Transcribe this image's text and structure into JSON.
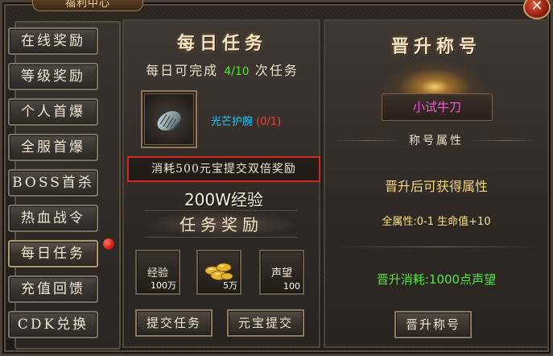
{
  "window": {
    "title": "福利中心",
    "close_label": "✕"
  },
  "sidebar": {
    "items": [
      {
        "label": "在线奖励"
      },
      {
        "label": "等级奖励"
      },
      {
        "label": "个人首爆"
      },
      {
        "label": "全服首爆"
      },
      {
        "label": "BOSS首杀"
      },
      {
        "label": "热血战令"
      },
      {
        "label": "每日任务"
      },
      {
        "label": "充值回馈"
      },
      {
        "label": "CDK兑换"
      }
    ],
    "active_index": 6,
    "notification_dot_on": "每日任务"
  },
  "daily_task": {
    "title": "每日任务",
    "prefix": "每日可完成",
    "count": "4/10",
    "suffix": "次任务",
    "item": {
      "icon": "bracer-icon",
      "name": "光芒护腕",
      "progress": "(0/1)"
    },
    "double_reward_note": "消耗500元宝提交双倍奖励",
    "exp_text": "200W经验",
    "reward_title": "任务奖励",
    "rewards": [
      {
        "label": "经验",
        "count": "100万"
      },
      {
        "label": "",
        "icon": "gold-ingot-icon",
        "count": "5万"
      },
      {
        "label": "声望",
        "count": "100"
      }
    ],
    "submit_button": "提交任务",
    "ingot_submit_button": "元宝提交"
  },
  "promotion": {
    "title": "晋升称号",
    "current_title": "小试牛刀",
    "attr_section": "称号属性",
    "gain_text": "晋升后可获得属性",
    "attributes": "全属性:0-1  生命值+10",
    "cost_text": "晋升消耗:1000点声望",
    "promote_button": "晋升称号"
  },
  "colors": {
    "count_green": "#54e23d",
    "item_name_cyan": "#20c7ff",
    "progress_red": "#ff3d3d",
    "title_pink": "#f25bd6",
    "attr_yellow": "#ffe27a",
    "cost_green": "#4cea3a",
    "highlight_red_border": "#d2261e"
  }
}
